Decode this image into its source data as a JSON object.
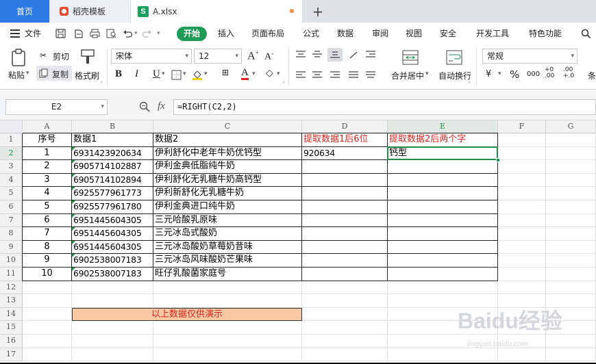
{
  "tabs": {
    "home": "首页",
    "daoke": "稻壳模板",
    "file": "A.xlsx",
    "add": "+"
  },
  "menu": {
    "file": "文件",
    "items": [
      "开始",
      "插入",
      "页面布局",
      "公式",
      "数据",
      "审阅",
      "视图",
      "安全",
      "开发工具",
      "特色功能"
    ],
    "search_icon": "search-icon"
  },
  "ribbon": {
    "paste": "粘贴",
    "cut": "剪切",
    "copy": "复制",
    "format_painter": "格式刷",
    "font_name": "宋体",
    "font_size": "12",
    "bold": "B",
    "italic": "I",
    "underline": "U",
    "merge_center": "合并居中",
    "wrap_text": "自动换行",
    "number_format": "常规",
    "percent": "%",
    "thousands": "000",
    "conditional": "条"
  },
  "formula_bar": {
    "name_box": "E2",
    "fx": "fx",
    "formula": "=RIGHT(C2,2)"
  },
  "grid": {
    "columns": [
      "A",
      "B",
      "C",
      "D",
      "E",
      "F",
      "G"
    ],
    "rows": [
      "1",
      "2",
      "3",
      "4",
      "5",
      "6",
      "7",
      "8",
      "9",
      "10",
      "11",
      "12",
      "13",
      "14",
      "15",
      "16",
      "17"
    ],
    "headers": {
      "A": "序号",
      "B": "数据1",
      "C": "数据2",
      "D": "提取数据1后6位",
      "E": "提取数据2后两个字"
    },
    "records": [
      {
        "no": "1",
        "d1": "6931423920634",
        "d2": "伊利舒化中老年牛奶优钙型",
        "d": "920634",
        "e": "钙型"
      },
      {
        "no": "2",
        "d1": "6905714102887",
        "d2": "伊利金典低脂纯牛奶",
        "d": "",
        "e": ""
      },
      {
        "no": "3",
        "d1": "6905714102894",
        "d2": "伊利舒化无乳糖牛奶高钙型",
        "d": "",
        "e": ""
      },
      {
        "no": "4",
        "d1": "6925577961773",
        "d2": "伊利新舒化无乳糖牛奶",
        "d": "",
        "e": ""
      },
      {
        "no": "5",
        "d1": "6925577961780",
        "d2": "伊利金典进口纯牛奶",
        "d": "",
        "e": ""
      },
      {
        "no": "6",
        "d1": "6951445604305",
        "d2": "三元哈酸乳原味",
        "d": "",
        "e": ""
      },
      {
        "no": "7",
        "d1": "6951445604305",
        "d2": "三元冰岛式酸奶",
        "d": "",
        "e": ""
      },
      {
        "no": "8",
        "d1": "6951445604305",
        "d2": "三元冰岛酸奶草莓奶昔味",
        "d": "",
        "e": ""
      },
      {
        "no": "9",
        "d1": "6902538007183",
        "d2": "三元冰岛风味酸奶芒果味",
        "d": "",
        "e": ""
      },
      {
        "no": "10",
        "d1": "6902538007183",
        "d2": "旺仔乳酸菌家庭号",
        "d": "",
        "e": ""
      }
    ],
    "note": "以上数据仅供演示",
    "selected_cell": "E2"
  },
  "watermark": {
    "main": "Baidu经验",
    "sub": "jingyan.baidu.com"
  },
  "colors": {
    "accent_blue": "#2f7be5",
    "start_green": "#1e9b57",
    "header_red": "#e0241f",
    "note_fill": "#f8c9a3",
    "selection_green": "#1d8f4a"
  }
}
